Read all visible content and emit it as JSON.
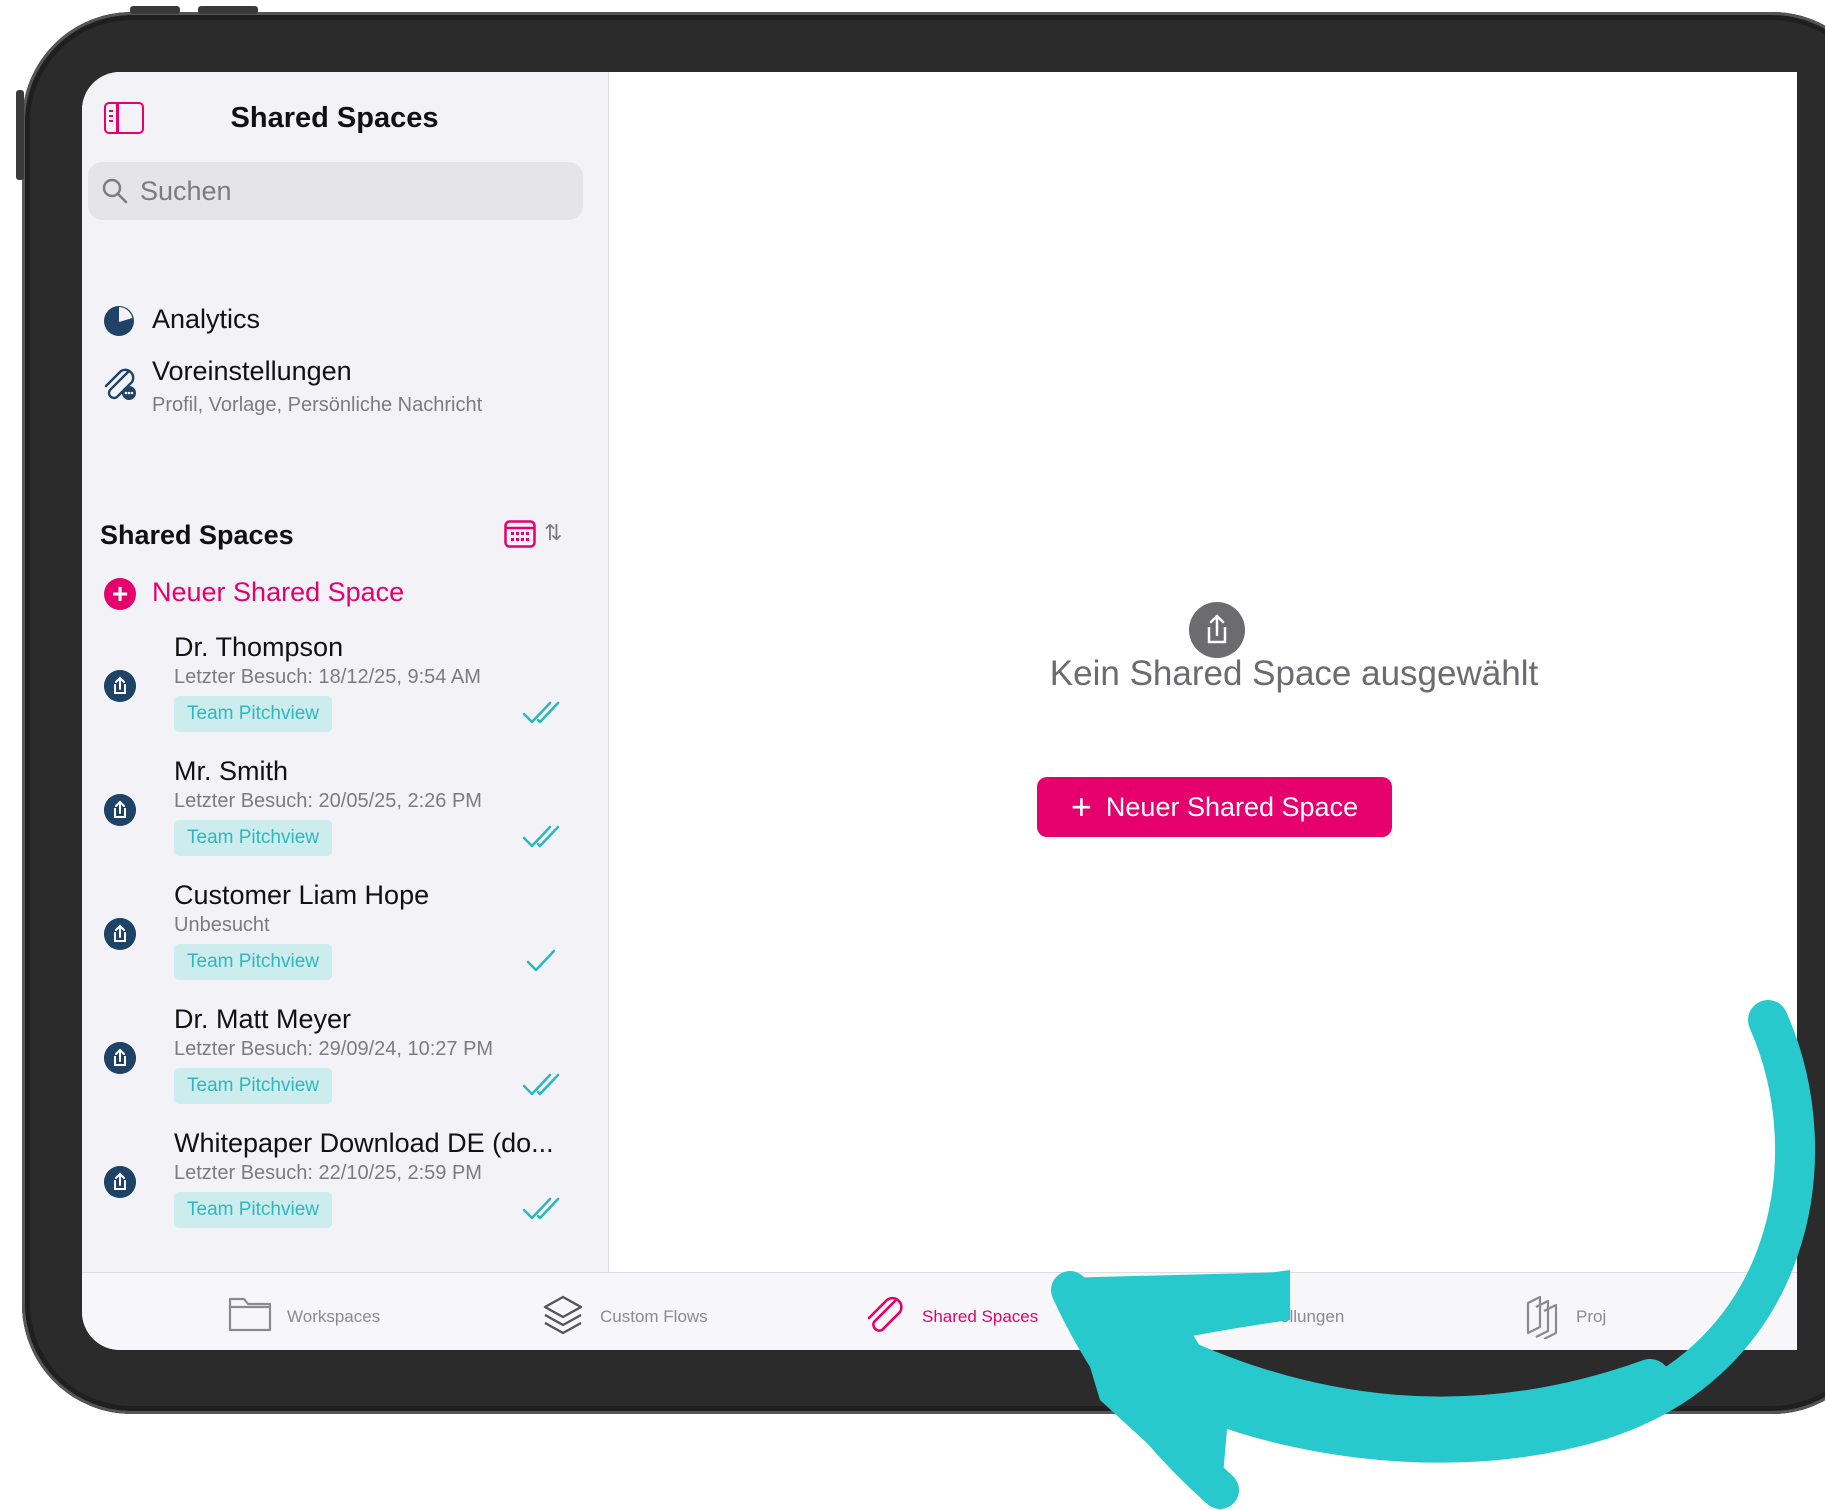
{
  "header": {
    "title": "Shared Spaces"
  },
  "search": {
    "placeholder": "Suchen"
  },
  "menu": [
    {
      "label": "Analytics",
      "icon": "pie-chart-icon"
    },
    {
      "label": "Voreinstellungen",
      "sub": "Profil, Vorlage, Persönliche Nachricht",
      "icon": "paperclip-settings-icon"
    }
  ],
  "section": {
    "title": "Shared Spaces",
    "new_label": "Neuer Shared Space"
  },
  "items": [
    {
      "title": "Dr. Thompson",
      "sub": "Letzter Besuch: 18/12/25, 9:54 AM",
      "badge": "Team Pitchview",
      "status": "double-check"
    },
    {
      "title": "Mr. Smith",
      "sub": "Letzter Besuch: 20/05/25, 2:26 PM",
      "badge": "Team Pitchview",
      "status": "double-check"
    },
    {
      "title": "Customer Liam Hope",
      "sub": "Unbesucht",
      "badge": "Team Pitchview",
      "status": "single-check"
    },
    {
      "title": "Dr. Matt Meyer",
      "sub": "Letzter Besuch: 29/09/24, 10:27 PM",
      "badge": "Team Pitchview",
      "status": "double-check"
    },
    {
      "title": "Whitepaper Download DE (do...",
      "sub": "Letzter Besuch: 22/10/25, 2:59 PM",
      "badge": "Team Pitchview",
      "status": "double-check"
    }
  ],
  "content": {
    "empty_text": "Kein Shared Space ausgewählt",
    "cta_label": "Neuer Shared Space",
    "cta_plus": "+"
  },
  "tabs": [
    {
      "label": "Workspaces",
      "icon": "folder-icon"
    },
    {
      "label": "Custom Flows",
      "icon": "layers-icon"
    },
    {
      "label": "Shared Spaces",
      "icon": "paperclip-icon",
      "active": true
    },
    {
      "label": "ellungen",
      "icon": "settings-icon"
    },
    {
      "label": "Proj",
      "icon": "projects-icon"
    }
  ],
  "colors": {
    "accent": "#e5006e",
    "teal": "#27c9cc",
    "navy": "#1f4366"
  }
}
